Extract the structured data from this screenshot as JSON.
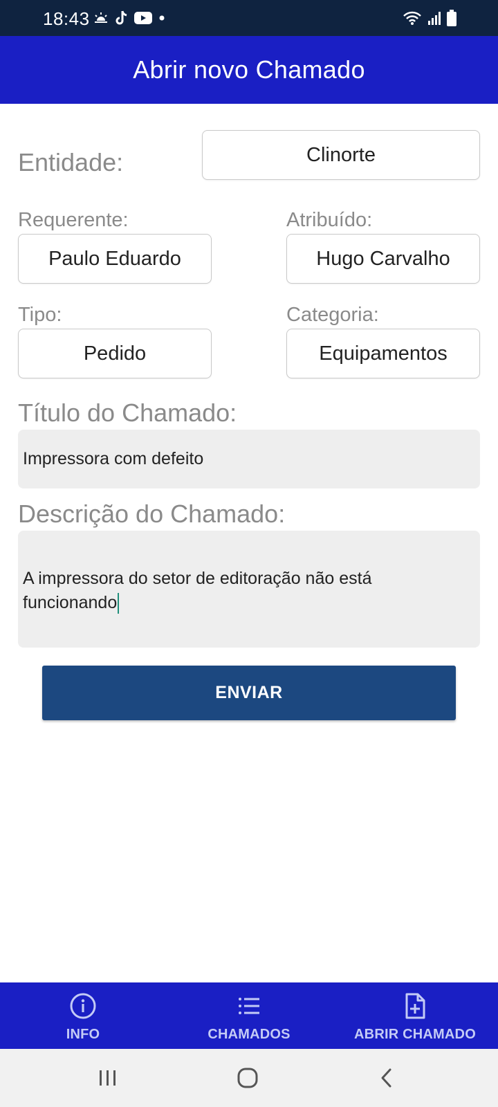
{
  "status_bar": {
    "time": "18:43",
    "left_icons": [
      "weather-icon",
      "tiktok-icon",
      "youtube-icon",
      "dot-icon"
    ],
    "right_icons": [
      "wifi-icon",
      "signal-icon",
      "battery-icon"
    ]
  },
  "app_bar": {
    "title": "Abrir novo Chamado"
  },
  "form": {
    "entidade": {
      "label": "Entidade:",
      "value": "Clinorte"
    },
    "requerente": {
      "label": "Requerente:",
      "value": "Paulo Eduardo"
    },
    "atribuido": {
      "label": "Atribuído:",
      "value": "Hugo Carvalho"
    },
    "tipo": {
      "label": "Tipo:",
      "value": "Pedido"
    },
    "categoria": {
      "label": "Categoria:",
      "value": "Equipamentos"
    },
    "titulo": {
      "label": "Título do Chamado:",
      "value": "Impressora com defeito"
    },
    "descricao": {
      "label": "Descrição do Chamado:",
      "value": "A impressora do setor de editoração não está funcionando"
    },
    "submit_label": "ENVIAR"
  },
  "bottom_nav": {
    "items": [
      {
        "label": "INFO",
        "icon": "info-icon"
      },
      {
        "label": "CHAMADOS",
        "icon": "list-icon"
      },
      {
        "label": "ABRIR CHAMADO",
        "icon": "add-document-icon"
      }
    ]
  },
  "system_nav": {
    "buttons": [
      "recents-icon",
      "home-icon",
      "back-icon"
    ]
  },
  "colors": {
    "app_bar": "#1a1fc4",
    "status_bar": "#0f2340",
    "submit_button": "#1c4880",
    "label_gray": "#8a8a8a",
    "input_fill": "#eeeeee",
    "nav_label": "#c4cbf6"
  }
}
